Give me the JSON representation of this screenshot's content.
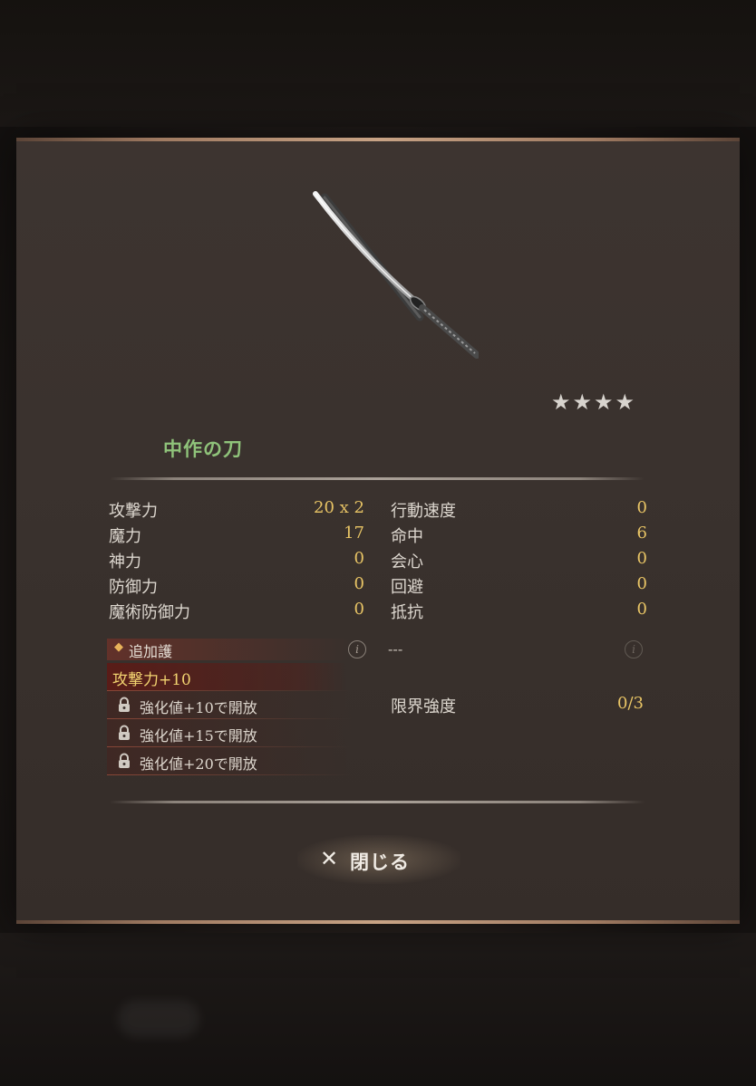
{
  "item": {
    "stars": "★★★★",
    "name": "中作の刀"
  },
  "stats_left": [
    {
      "label": "攻撃力",
      "value": "20 x 2"
    },
    {
      "label": "魔力",
      "value": "17"
    },
    {
      "label": "神力",
      "value": "0"
    },
    {
      "label": "防御力",
      "value": "0"
    },
    {
      "label": "魔術防御力",
      "value": "0"
    }
  ],
  "stats_right": [
    {
      "label": "行動速度",
      "value": "0"
    },
    {
      "label": "命中",
      "value": "6"
    },
    {
      "label": "会心",
      "value": "0"
    },
    {
      "label": "回避",
      "value": "0"
    },
    {
      "label": "抵抗",
      "value": "0"
    }
  ],
  "extra": {
    "diamond": "◆",
    "title": "追加護",
    "info_glyph": "i",
    "right_placeholder": "---",
    "bonus": "攻撃力+10",
    "locked": [
      "強化値+10で開放",
      "強化値+15で開放",
      "強化値+20で開放"
    ]
  },
  "limit": {
    "label": "限界強度",
    "value": "0/3"
  },
  "close_button": {
    "icon": "✕",
    "label": "閉じる"
  },
  "colors": {
    "item_name": "#8fc37a",
    "stat_value": "#e8c465",
    "bonus_text": "#f2d370"
  }
}
